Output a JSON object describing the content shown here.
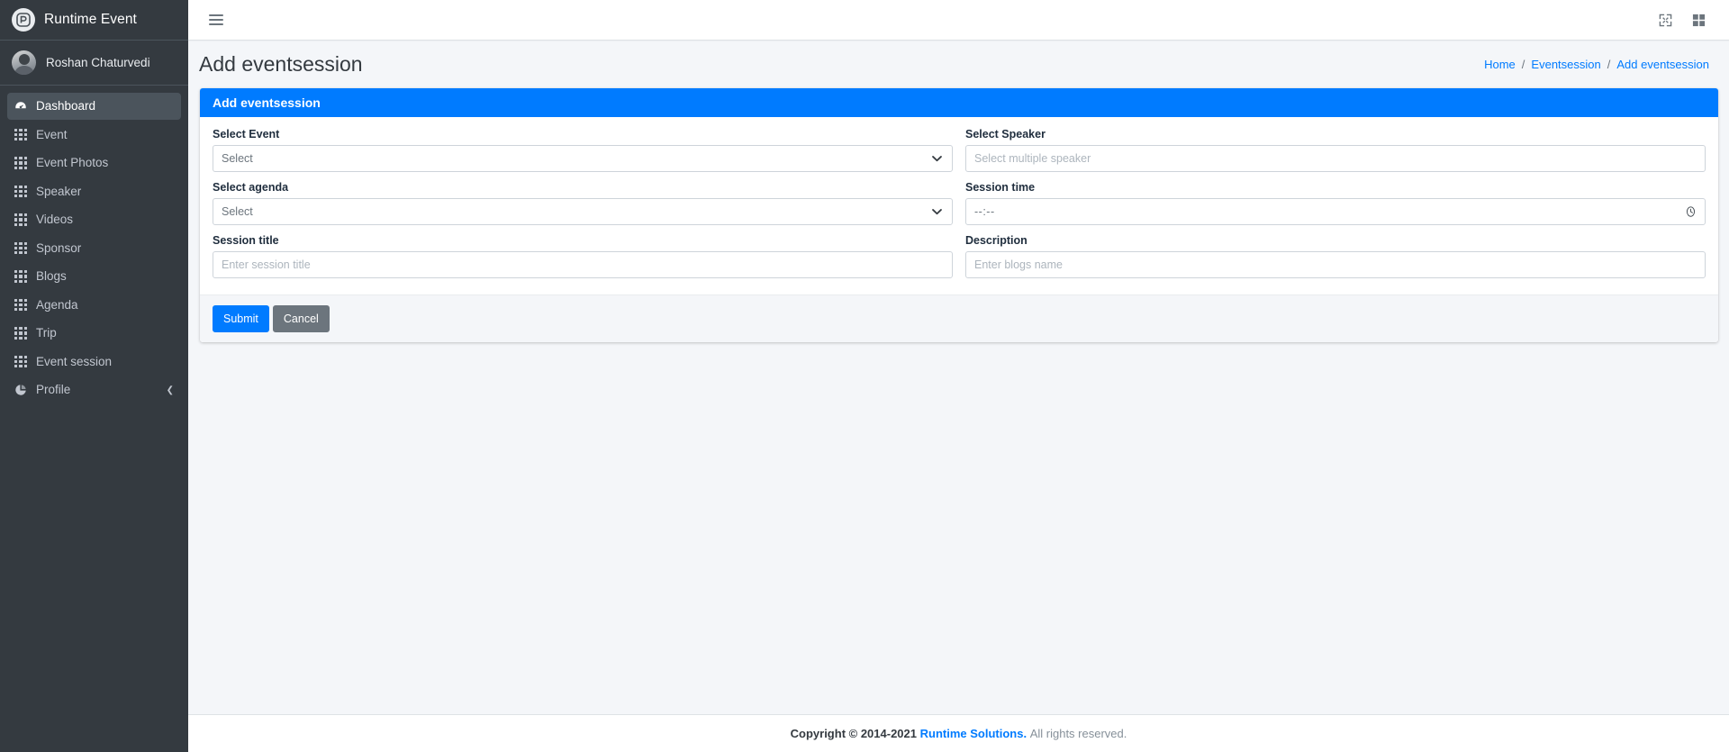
{
  "brand": {
    "name": "Runtime Event",
    "logo_icon": "runtime-logo-icon"
  },
  "user": {
    "name": "Roshan Chaturvedi"
  },
  "sidebar": {
    "items": [
      {
        "label": "Dashboard",
        "icon": "dashboard-icon",
        "active": true
      },
      {
        "label": "Event",
        "icon": "grid-icon",
        "active": false
      },
      {
        "label": "Event Photos",
        "icon": "grid-icon",
        "active": false
      },
      {
        "label": "Speaker",
        "icon": "grid-icon",
        "active": false
      },
      {
        "label": "Videos",
        "icon": "grid-icon",
        "active": false
      },
      {
        "label": "Sponsor",
        "icon": "grid-icon",
        "active": false
      },
      {
        "label": "Blogs",
        "icon": "grid-icon",
        "active": false
      },
      {
        "label": "Agenda",
        "icon": "grid-icon",
        "active": false
      },
      {
        "label": "Trip",
        "icon": "grid-icon",
        "active": false
      },
      {
        "label": "Event session",
        "icon": "grid-icon",
        "active": false
      },
      {
        "label": "Profile",
        "icon": "pie-chart-icon",
        "active": false,
        "chevron": "chevron-left-icon"
      }
    ]
  },
  "topbar": {
    "menu_toggle_icon": "hamburger-icon",
    "fullscreen_icon": "fullscreen-expand-icon",
    "apps_icon": "apps-grid-icon"
  },
  "header": {
    "title": "Add eventsession",
    "breadcrumb": [
      {
        "label": "Home"
      },
      {
        "label": "Eventsession"
      },
      {
        "label": "Add eventsession"
      }
    ],
    "separator": "/"
  },
  "card": {
    "title": "Add eventsession",
    "fields": {
      "select_event": {
        "label": "Select Event",
        "placeholder": "Select",
        "value": "",
        "type": "select"
      },
      "select_speaker": {
        "label": "Select Speaker",
        "placeholder": "Select multiple speaker",
        "value": "",
        "type": "text"
      },
      "select_agenda": {
        "label": "Select agenda",
        "placeholder": "Select",
        "value": "",
        "type": "select"
      },
      "session_time": {
        "label": "Session time",
        "placeholder": "--:--",
        "value": "--:--",
        "type": "time"
      },
      "session_title": {
        "label": "Session title",
        "placeholder": "Enter session title",
        "value": "",
        "type": "text"
      },
      "description": {
        "label": "Description",
        "placeholder": "Enter blogs name",
        "value": "",
        "type": "text"
      }
    },
    "submit_label": "Submit",
    "cancel_label": "Cancel"
  },
  "footer": {
    "copyright_prefix": "Copyright © 2014-2021",
    "company": "Runtime Solutions.",
    "rights": "All rights reserved."
  },
  "colors": {
    "accent": "#007bff",
    "sidebar_bg": "#343a40",
    "page_bg": "#f4f6f9",
    "secondary": "#6c757d"
  }
}
